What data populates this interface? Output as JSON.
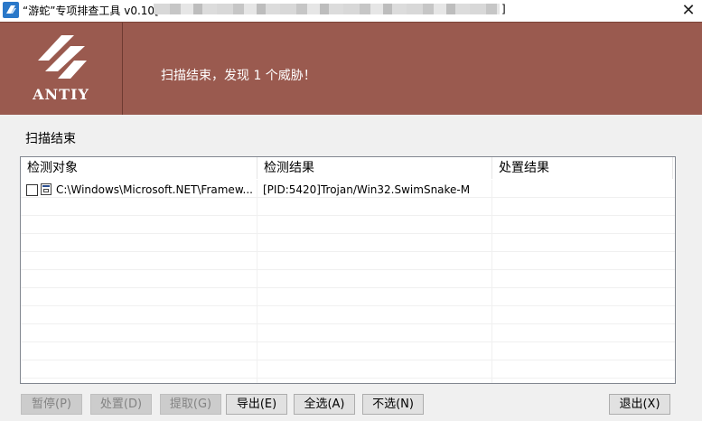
{
  "window": {
    "title": "“游蛇”专项排查工具 v0.10[",
    "title_end": "]",
    "close_glyph": "✕"
  },
  "header": {
    "logo_text": "ANTIY",
    "message": "扫描结束，发现 1 个威胁！",
    "bg_color": "#9a5a4f"
  },
  "status": {
    "text": "扫描结束"
  },
  "table": {
    "columns": [
      "检测对象",
      "检测结果",
      "处置结果"
    ],
    "rows": [
      {
        "checked": false,
        "object": "C:\\Windows\\Microsoft.NET\\Framew...",
        "result": "[PID:5420]Trojan/Win32.SwimSnake-M",
        "action": ""
      }
    ]
  },
  "buttons": {
    "pause": "暂停(P)",
    "dispose": "处置(D)",
    "extract": "提取(G)",
    "export": "导出(E)",
    "select_all": "全选(A)",
    "select_none": "不选(N)",
    "exit": "退出(X)"
  }
}
